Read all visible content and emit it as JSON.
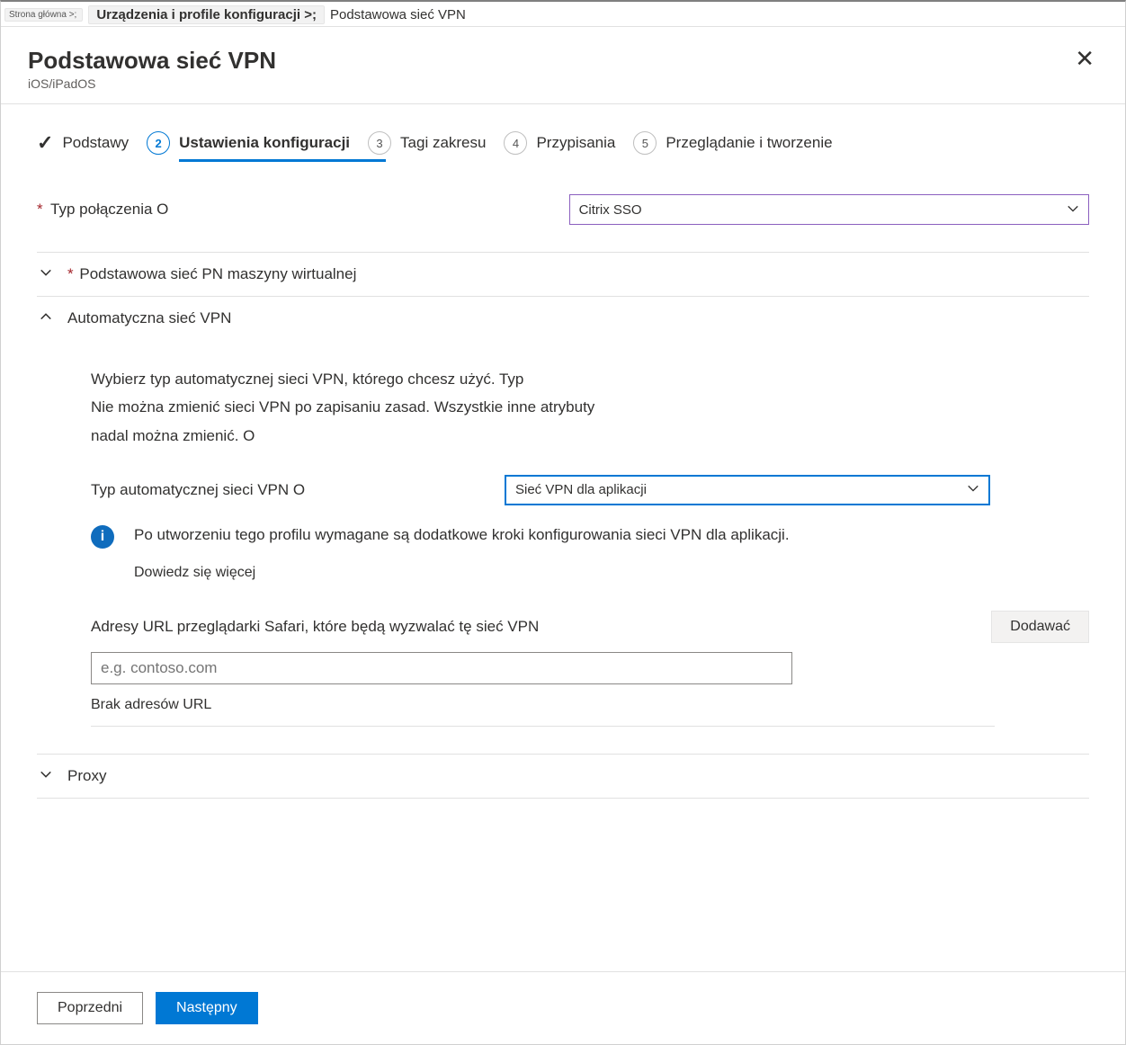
{
  "breadcrumb": {
    "home": "Strona główna >;",
    "main": "Urządzenia i profile konfiguracji >;",
    "last": "Podstawowa sieć VPN"
  },
  "header": {
    "title": "Podstawowa sieć VPN",
    "subtitle": "iOS/iPadOS"
  },
  "stepper": {
    "s1": "Podstawy",
    "s2_num": "2",
    "s2": "Ustawienia konfiguracji",
    "s3_num": "3",
    "s3": "Tagi zakresu",
    "s4_num": "4",
    "s4": "Przypisania",
    "s5_num": "5",
    "s5": "Przeglądanie i tworzenie"
  },
  "fields": {
    "connection_type_label": "Typ połączenia O",
    "connection_type_value": "Citrix SSO"
  },
  "sections": {
    "base": {
      "title": "Podstawowa sieć PN maszyny wirtualnej"
    },
    "auto": {
      "title": "Automatyczna sieć VPN",
      "desc_l1": "Wybierz typ automatycznej sieci VPN, którego chcesz użyć. Typ",
      "desc_l2": "Nie można zmienić sieci VPN po zapisaniu zasad. Wszystkie inne atrybuty",
      "desc_l3": "nadal można zmienić. O",
      "type_label": "Typ automatycznej sieci VPN O",
      "type_value": "Sieć VPN dla aplikacji",
      "info_text": "Po utworzeniu tego profilu wymagane są dodatkowe kroki konfigurowania sieci VPN dla aplikacji.",
      "learn_more": "Dowiedz się więcej",
      "urls_label": "Adresy URL przeglądarki Safari, które będą wyzwalać tę sieć VPN",
      "urls_placeholder": "e.g. contoso.com",
      "no_urls": "Brak adresów URL",
      "add_button": "Dodawać"
    },
    "proxy": {
      "title": "Proxy"
    }
  },
  "footer": {
    "prev": "Poprzedni",
    "next": "Następny"
  },
  "required_mark": "*"
}
